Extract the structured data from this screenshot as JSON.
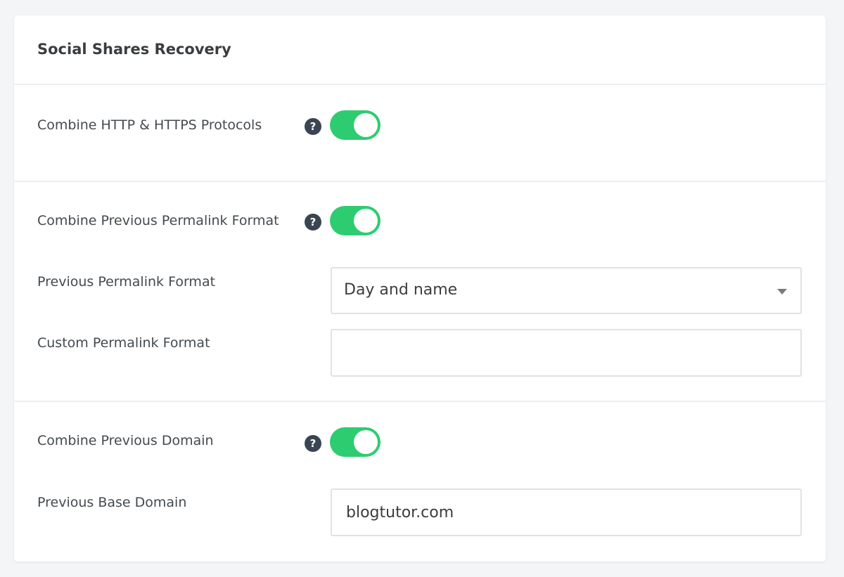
{
  "panel": {
    "title": "Social Shares Recovery"
  },
  "section_protocols": {
    "combine_label": "Combine HTTP & HTTPS Protocols",
    "help_icon_glyph": "?",
    "toggle_state": "on"
  },
  "section_permalink": {
    "combine_label": "Combine Previous Permalink Format",
    "help_icon_glyph": "?",
    "toggle_state": "on",
    "previous_format_label": "Previous Permalink Format",
    "previous_format_value": "Day and name",
    "custom_format_label": "Custom Permalink Format",
    "custom_format_value": ""
  },
  "section_domain": {
    "combine_label": "Combine Previous Domain",
    "help_icon_glyph": "?",
    "toggle_state": "on",
    "base_domain_label": "Previous Base Domain",
    "base_domain_value": "blogtutor.com"
  },
  "colors": {
    "toggle_on": "#2ecc71",
    "help_icon_bg": "#3a4452",
    "page_bg": "#f3f5f6",
    "divider": "#eceff1"
  },
  "icons": {
    "help": "question-circle-icon",
    "dropdown": "caret-down-icon"
  }
}
